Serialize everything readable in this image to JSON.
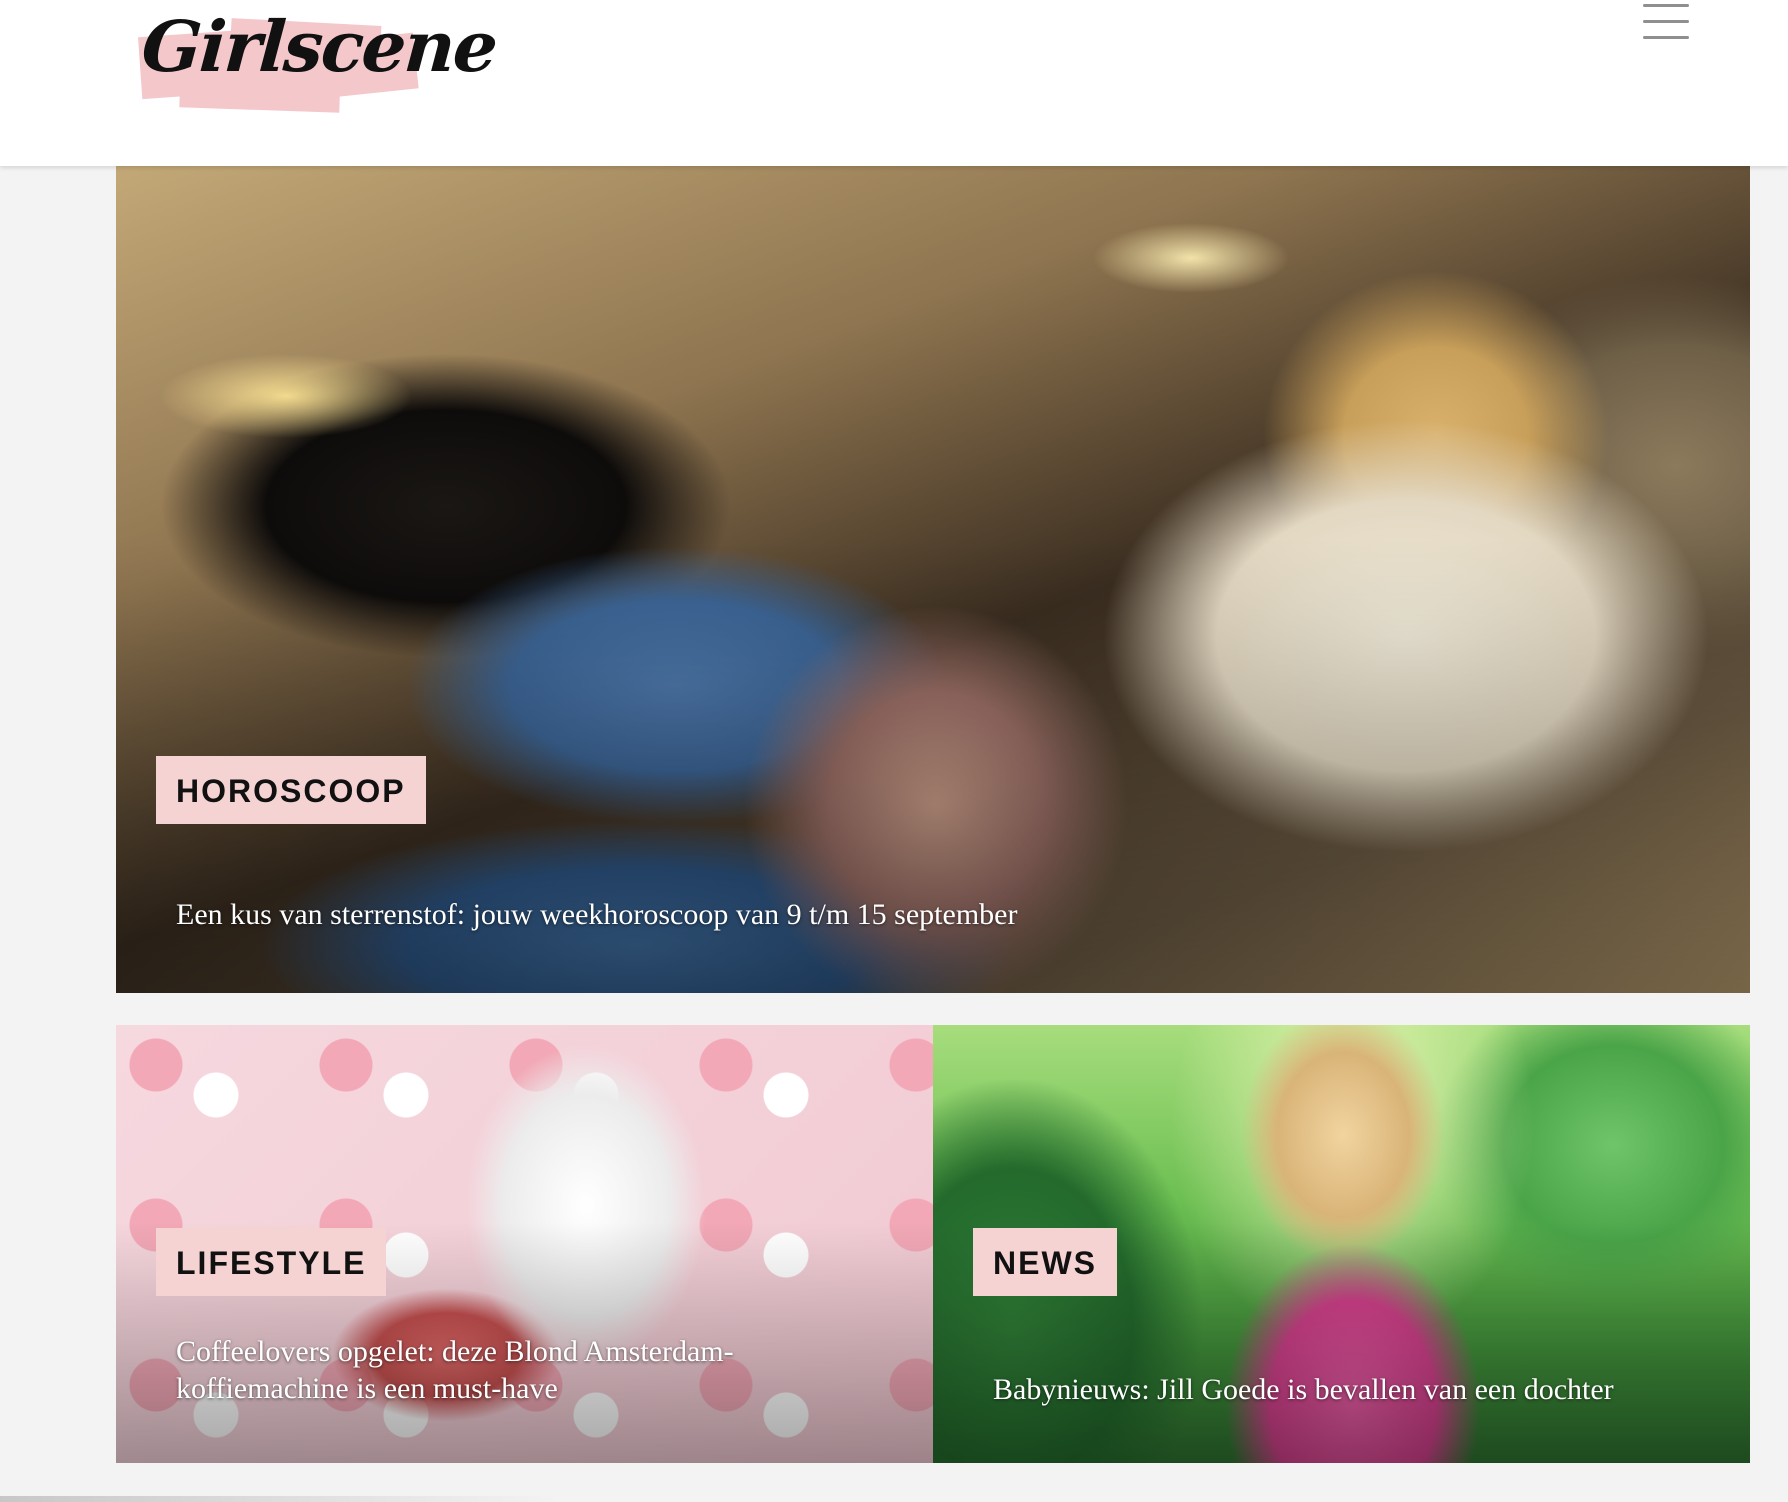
{
  "header": {
    "logo_text": "Girlscene",
    "menu_icon": "hamburger-menu-icon"
  },
  "colors": {
    "badge_bg": "#f6d3d3",
    "logo_accent": "#f4c7cb",
    "title_text": "#ffffff"
  },
  "articles": [
    {
      "category": "HOROSCOOP",
      "title": "Een kus van sterrenstof: jouw weekhoroscoop van 9 t/m 15 september"
    },
    {
      "category": "LIFESTYLE",
      "title": "Coffeelovers opgelet: deze Blond Amsterdam-koffiemachine is een must-have"
    },
    {
      "category": "NEWS",
      "title": "Babynieuws: Jill Goede is bevallen van een dochter"
    }
  ]
}
